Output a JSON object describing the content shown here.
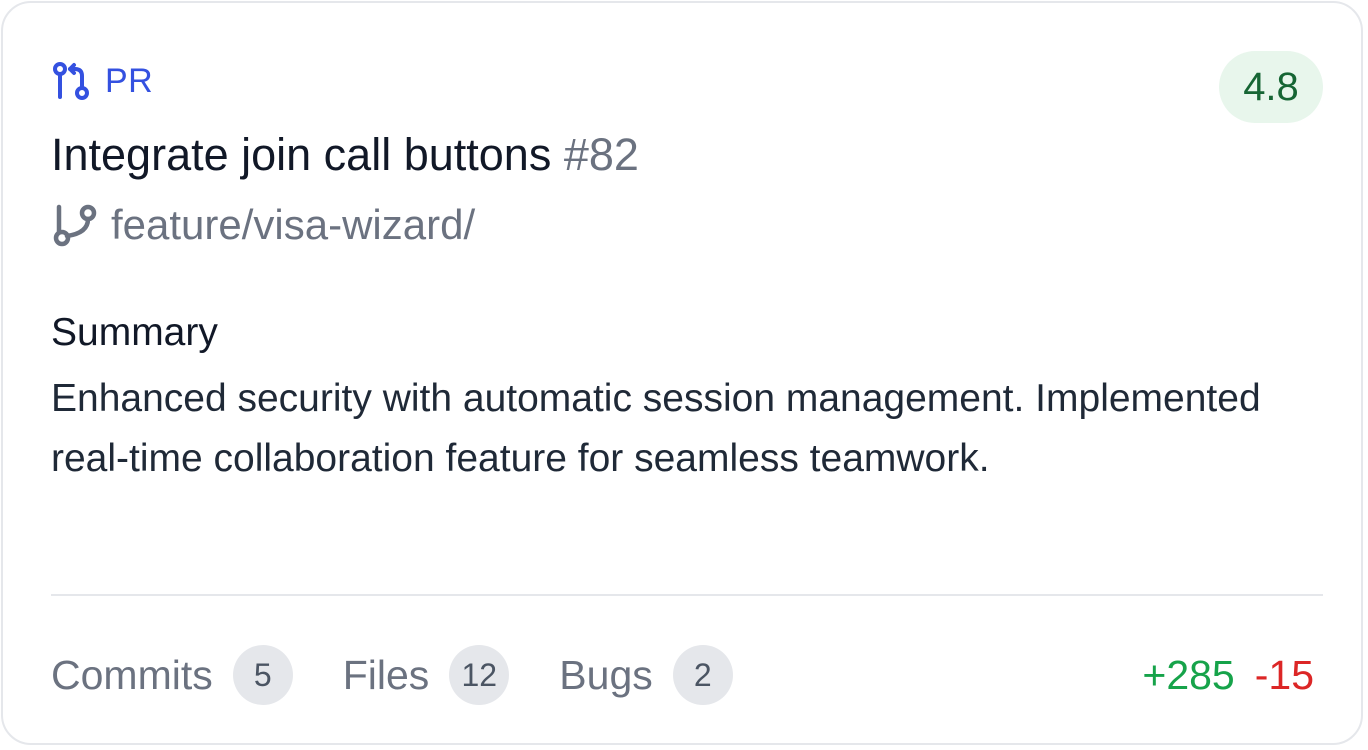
{
  "card": {
    "type_label": "PR",
    "type_icon": "git-pull-request-icon",
    "score": "4.8",
    "title": "Integrate join call buttons",
    "number": "#82",
    "branch_icon": "git-branch-icon",
    "branch": "feature/visa-wizard/",
    "summary_heading": "Summary",
    "summary_text": "Enhanced security with automatic session management. Implemented real-time collaboration feature for seamless teamwork.",
    "stats": {
      "commits_label": "Commits",
      "commits_count": "5",
      "files_label": "Files",
      "files_count": "12",
      "bugs_label": "Bugs",
      "bugs_count": "2"
    },
    "additions": "+285",
    "deletions": "-15"
  },
  "colors": {
    "accent": "#3451e0",
    "score_bg": "#e8f6ec",
    "score_text": "#166534",
    "additions": "#16a34a",
    "deletions": "#dc2626"
  }
}
